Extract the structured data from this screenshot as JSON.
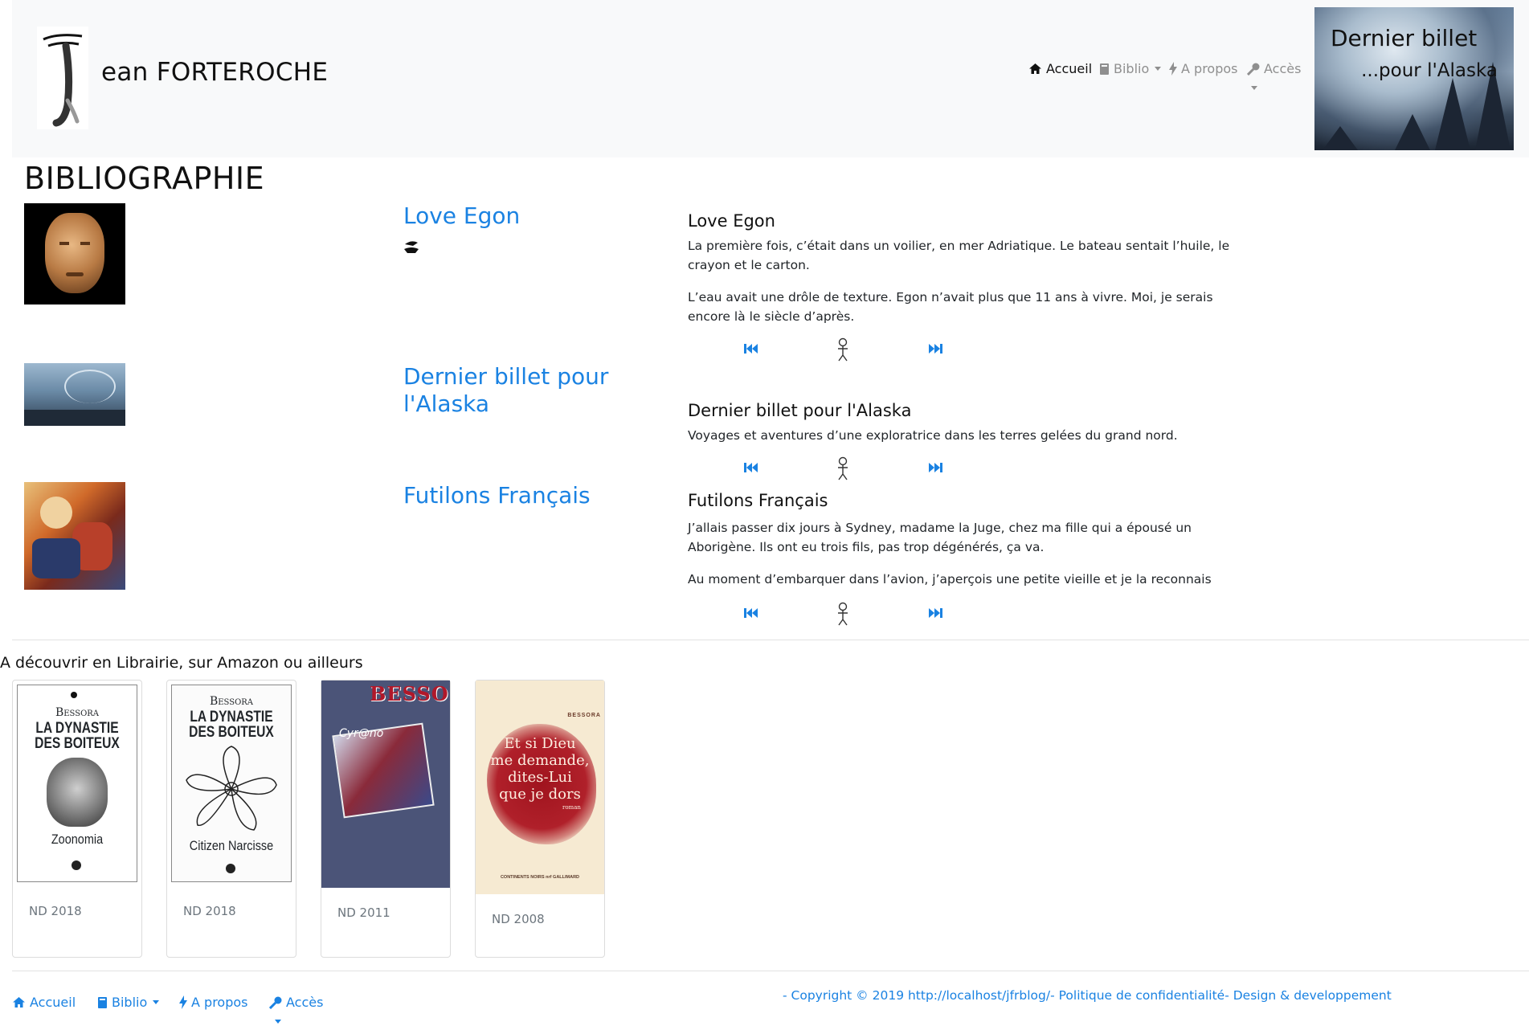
{
  "header": {
    "logo_letter": "J",
    "site_title": "ean FORTEROCHE",
    "nav": [
      {
        "label": "Accueil",
        "icon": "home-icon",
        "active": true
      },
      {
        "label": "Biblio",
        "icon": "book-icon",
        "dropdown": true
      },
      {
        "label": "A propos",
        "icon": "bolt-icon"
      },
      {
        "label": "Accès",
        "icon": "key-icon",
        "dropdown": true
      }
    ],
    "hero": {
      "line1": "Dernier billet",
      "line2": "...pour l'Alaska"
    }
  },
  "page_title": "BIBLIOGRAPHIE",
  "books": [
    {
      "link": "Love Egon",
      "has_icon": true,
      "detail_title": "Love Egon",
      "paragraphs": [
        "La première fois, c’était dans un voilier, en mer Adriatique. Le bateau sentait l’huile, le crayon et le carton.",
        "L’eau avait une drôle de texture. Egon n’avait plus que 11 ans à vivre. Moi, je serais encore là le siècle d’après."
      ]
    },
    {
      "link": "Dernier billet pour l'Alaska",
      "detail_title": "Dernier billet pour l'Alaska",
      "paragraphs": [
        "Voyages et aventures d’une exploratrice dans les terres gelées du grand nord."
      ]
    },
    {
      "link": "Futilons Français",
      "detail_title": "Futilons Français",
      "paragraphs": [
        "J’allais passer dix jours à Sydney, madame la Juge, chez ma fille qui a épousé un Aborigène. Ils ont eu trois fils, pas trop dégénérés, ça va.",
        "Au moment d’embarquer dans l’avion, j’aperçois une petite vieille et je la reconnais"
      ]
    }
  ],
  "controls": {
    "prev_icon": "skip-back-icon",
    "center_icon": "figure-icon",
    "next_icon": "skip-forward-icon"
  },
  "shelf": {
    "title": "A découvrir en Librairie, sur Amazon ou ailleurs",
    "cards": [
      {
        "cover_author": "Bessora",
        "cover_title1": "LA DYNASTIE",
        "cover_title2": "DES BOITEUX",
        "cover_sub": "Zoonomia",
        "year": "ND 2018"
      },
      {
        "cover_author": "Bessora",
        "cover_title1": "LA DYNASTIE",
        "cover_title2": "DES BOITEUX",
        "cover_sub": "Citizen Narcisse",
        "year": "ND 2018"
      },
      {
        "cover_author": "BESSORA",
        "cover_title1": "Cyr@no",
        "year": "ND 2011"
      },
      {
        "cover_author": "BESSORA",
        "cover_title1": "Et si Dieu",
        "cover_title2": "me demande,",
        "cover_title3": "dites-Lui",
        "cover_title4": "que je dors",
        "cover_small": "roman",
        "cover_publisher": "CONTINENTS NOIRS nrf GALLIMARD",
        "year": "ND 2008"
      }
    ]
  },
  "footer": {
    "nav": [
      {
        "label": "Accueil",
        "icon": "home-icon"
      },
      {
        "label": "Biblio",
        "icon": "book-icon",
        "dropdown": true
      },
      {
        "label": "A propos",
        "icon": "bolt-icon"
      },
      {
        "label": "Accès",
        "icon": "key-icon",
        "dropdown": true
      }
    ],
    "copyright": "- Copyright © 2019 http://localhost/jfrblog/- Politique de confidentialité- Design & developpement"
  },
  "colors": {
    "link": "#1a82e2",
    "header_bg": "#f8f9fa",
    "muted": "#8f8f8f"
  }
}
